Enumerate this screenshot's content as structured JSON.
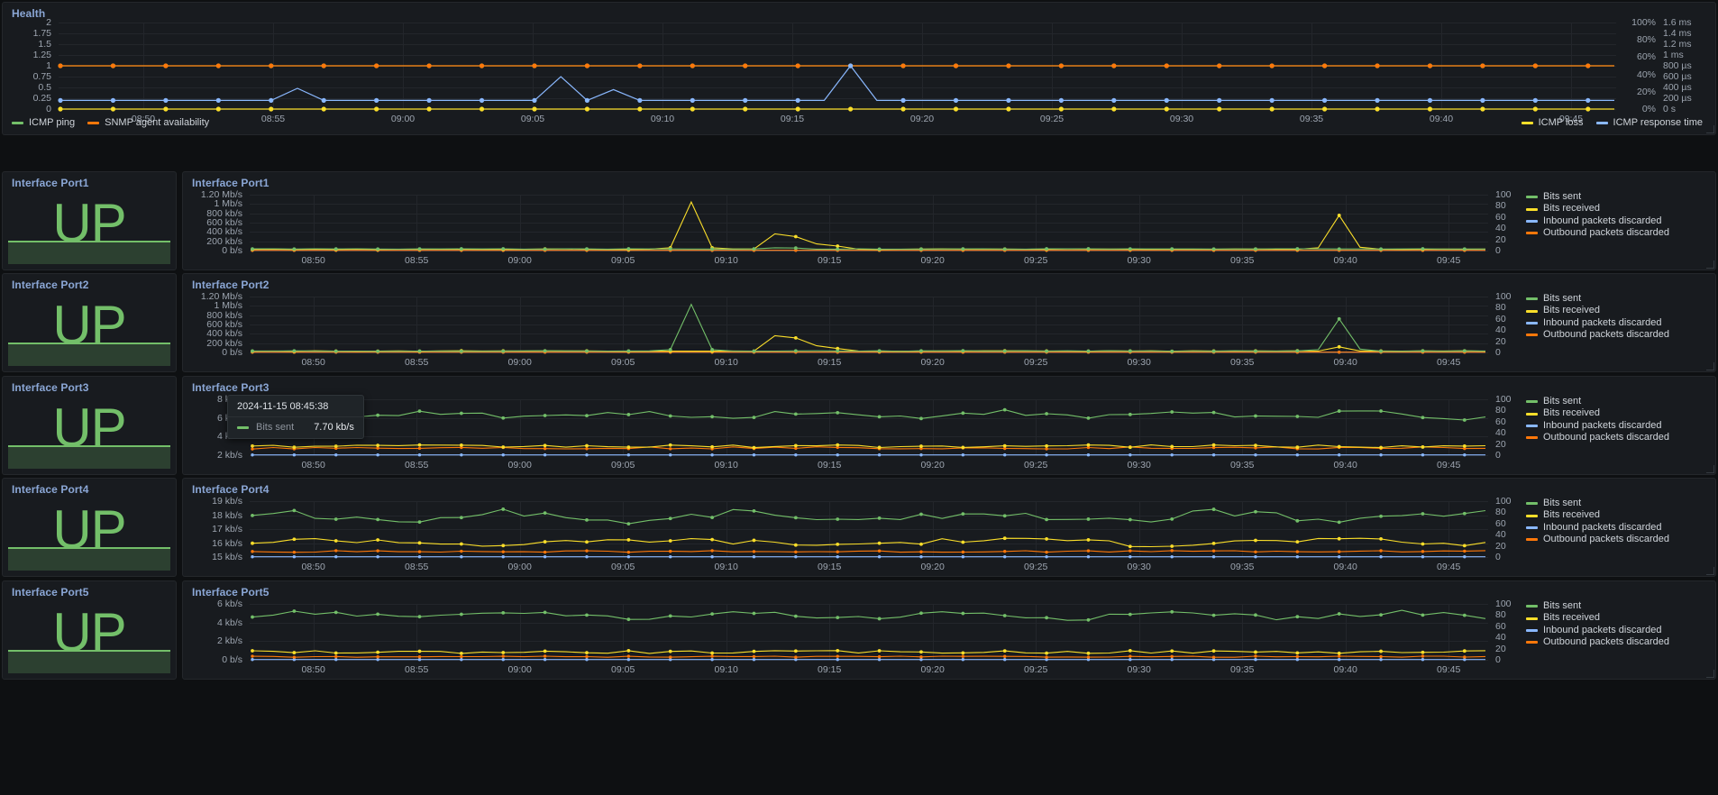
{
  "theme": {
    "bg": "#0e1012",
    "panel_bg": "#181b1f",
    "title_color": "#8ba7d6",
    "green": "#73bf69",
    "yellow": "#fade2a",
    "blue": "#8ab8ff",
    "orange": "#ff780a",
    "dark_yellow": "#e0b400"
  },
  "health": {
    "title": "Health",
    "y_left_ticks": [
      "2",
      "1.75",
      "1.5",
      "1.25",
      "1",
      "0.75",
      "0.5",
      "0.25",
      "0"
    ],
    "y_right1_ticks": [
      "100%",
      "80%",
      "60%",
      "40%",
      "20%",
      "0%"
    ],
    "y_right2_ticks": [
      "1.6 ms",
      "1.4 ms",
      "1.2 ms",
      "1 ms",
      "800 µs",
      "600 µs",
      "400 µs",
      "200 µs",
      "0 s"
    ],
    "x_ticks": [
      "08:50",
      "08:55",
      "09:00",
      "09:05",
      "09:10",
      "09:15",
      "09:20",
      "09:25",
      "09:30",
      "09:35",
      "09:40",
      "09:45"
    ],
    "legend_left": [
      {
        "label": "ICMP ping",
        "color": "#73bf69"
      },
      {
        "label": "SNMP agent availability",
        "color": "#ff780a"
      }
    ],
    "legend_right": [
      {
        "label": "ICMP loss",
        "color": "#fade2a"
      },
      {
        "label": "ICMP response time",
        "color": "#8ab8ff"
      }
    ]
  },
  "chart_data": [
    {
      "id": "health",
      "type": "line",
      "title": "Health",
      "xlabel": "",
      "ylabel": "",
      "ylim": [
        0,
        2
      ],
      "grid": true,
      "legend_position": "bottom",
      "x": [
        "08:46",
        "08:47",
        "08:48",
        "08:49",
        "08:50",
        "08:51",
        "08:52",
        "08:53",
        "08:54",
        "08:55",
        "08:56",
        "08:57",
        "08:58",
        "08:59",
        "09:00",
        "09:01",
        "09:02",
        "09:03",
        "09:04",
        "09:05",
        "09:06",
        "09:07",
        "09:08",
        "09:09",
        "09:10",
        "09:11",
        "09:12",
        "09:13",
        "09:14",
        "09:15",
        "09:16",
        "09:17",
        "09:18",
        "09:19",
        "09:20",
        "09:21",
        "09:22",
        "09:23",
        "09:24",
        "09:25",
        "09:26",
        "09:27",
        "09:28",
        "09:29",
        "09:30",
        "09:31",
        "09:32",
        "09:33",
        "09:34",
        "09:35",
        "09:36",
        "09:37",
        "09:38",
        "09:39",
        "09:40",
        "09:41",
        "09:42",
        "09:43",
        "09:44",
        "09:45"
      ],
      "series": [
        {
          "name": "ICMP ping",
          "color": "#73bf69",
          "axis": "left",
          "unit": "",
          "values": [
            1,
            1,
            1,
            1,
            1,
            1,
            1,
            1,
            1,
            1,
            1,
            1,
            1,
            1,
            1,
            1,
            1,
            1,
            1,
            1,
            1,
            1,
            1,
            1,
            1,
            1,
            1,
            1,
            1,
            1,
            1,
            1,
            1,
            1,
            1,
            1,
            1,
            1,
            1,
            1,
            1,
            1,
            1,
            1,
            1,
            1,
            1,
            1,
            1,
            1,
            1,
            1,
            1,
            1,
            1,
            1,
            1,
            1,
            1,
            1
          ]
        },
        {
          "name": "SNMP agent availability",
          "color": "#ff780a",
          "axis": "left",
          "unit": "",
          "values": [
            1,
            1,
            1,
            1,
            1,
            1,
            1,
            1,
            1,
            1,
            1,
            1,
            1,
            1,
            1,
            1,
            1,
            1,
            1,
            1,
            1,
            1,
            1,
            1,
            1,
            1,
            1,
            1,
            1,
            1,
            1,
            1,
            1,
            1,
            1,
            1,
            1,
            1,
            1,
            1,
            1,
            1,
            1,
            1,
            1,
            1,
            1,
            1,
            1,
            1,
            1,
            1,
            1,
            1,
            1,
            1,
            1,
            1,
            1,
            1
          ]
        },
        {
          "name": "ICMP loss",
          "color": "#fade2a",
          "axis": "right-percent",
          "unit": "%",
          "values": [
            0,
            0,
            0,
            0,
            0,
            0,
            0,
            0,
            0,
            0,
            0,
            0,
            0,
            0,
            0,
            0,
            0,
            0,
            0,
            0,
            0,
            0,
            0,
            0,
            0,
            0,
            0,
            0,
            0,
            0,
            0,
            0,
            0,
            0,
            0,
            0,
            0,
            0,
            0,
            0,
            0,
            0,
            0,
            0,
            0,
            0,
            0,
            0,
            0,
            0,
            0,
            0,
            0,
            0,
            0,
            0,
            0,
            0,
            0,
            0
          ]
        },
        {
          "name": "ICMP response time",
          "color": "#8ab8ff",
          "axis": "right-time",
          "unit": "ms",
          "values": [
            0.2,
            0.2,
            0.2,
            0.2,
            0.2,
            0.2,
            0.2,
            0.2,
            0.2,
            0.48,
            0.2,
            0.2,
            0.2,
            0.2,
            0.2,
            0.2,
            0.2,
            0.2,
            0.2,
            0.75,
            0.2,
            0.45,
            0.2,
            0.2,
            0.2,
            0.2,
            0.2,
            0.2,
            0.2,
            0.2,
            1.0,
            0.2,
            0.2,
            0.2,
            0.2,
            0.2,
            0.2,
            0.2,
            0.2,
            0.2,
            0.2,
            0.2,
            0.2,
            0.2,
            0.2,
            0.2,
            0.2,
            0.2,
            0.2,
            0.2,
            0.2,
            0.2,
            0.2,
            0.2,
            0.2,
            0.2,
            0.2,
            0.2,
            0.2,
            0.2
          ]
        }
      ]
    },
    {
      "id": "port1",
      "type": "line",
      "title": "Interface Port1",
      "ylim": [
        0,
        1200000
      ],
      "y_ticks": [
        "1.20 Mb/s",
        "1 Mb/s",
        "800 kb/s",
        "600 kb/s",
        "400 kb/s",
        "200 kb/s",
        "0 b/s"
      ],
      "y_right_ticks": [
        "100",
        "80",
        "60",
        "40",
        "20",
        "0"
      ],
      "series": [
        {
          "name": "Bits sent",
          "color": "#73bf69",
          "values_peak_kbps": 40
        },
        {
          "name": "Bits received",
          "color": "#fade2a",
          "values_peak_kbps": 1050
        },
        {
          "name": "Inbound packets discarded",
          "color": "#8ab8ff",
          "values_peak_kbps": 0
        },
        {
          "name": "Outbound packets discarded",
          "color": "#ff780a",
          "values_peak_kbps": 0
        }
      ]
    },
    {
      "id": "port2",
      "type": "line",
      "title": "Interface Port2",
      "ylim": [
        0,
        1200000
      ],
      "y_ticks": [
        "1.20 Mb/s",
        "1 Mb/s",
        "800 kb/s",
        "600 kb/s",
        "400 kb/s",
        "200 kb/s",
        "0 b/s"
      ],
      "y_right_ticks": [
        "100",
        "80",
        "60",
        "40",
        "20",
        "0"
      ],
      "series": [
        {
          "name": "Bits sent",
          "color": "#73bf69",
          "values_peak_kbps": 1010
        },
        {
          "name": "Bits received",
          "color": "#fade2a",
          "values_peak_kbps": 330
        },
        {
          "name": "Inbound packets discarded",
          "color": "#8ab8ff",
          "values_peak_kbps": 0
        },
        {
          "name": "Outbound packets discarded",
          "color": "#ff780a",
          "values_peak_kbps": 0
        }
      ]
    },
    {
      "id": "port3",
      "type": "line",
      "title": "Interface Port3",
      "ylim": [
        1000,
        9000
      ],
      "y_ticks": [
        "8 kb/s",
        "6 kb/s",
        "4 kb/s",
        "2 kb/s"
      ],
      "y_right_ticks": [
        "100",
        "80",
        "60",
        "40",
        "20",
        "0"
      ],
      "series": [
        {
          "name": "Bits sent",
          "color": "#73bf69",
          "values_avg_kbps": 7.0
        },
        {
          "name": "Bits received",
          "color": "#fade2a",
          "values_avg_kbps": 2.0
        },
        {
          "name": "Inbound packets discarded",
          "color": "#8ab8ff",
          "values_avg_kbps": 0
        },
        {
          "name": "Outbound packets discarded",
          "color": "#ff780a",
          "values_avg_kbps": 1.85
        }
      ]
    },
    {
      "id": "port4",
      "type": "line",
      "title": "Interface Port4",
      "ylim": [
        14500,
        19500
      ],
      "y_ticks": [
        "19 kb/s",
        "18 kb/s",
        "17 kb/s",
        "16 kb/s",
        "15 kb/s"
      ],
      "y_right_ticks": [
        "100",
        "80",
        "60",
        "40",
        "20",
        "0"
      ],
      "series": [
        {
          "name": "Bits sent",
          "color": "#73bf69",
          "values_avg_kbps": 18.3
        },
        {
          "name": "Bits received",
          "color": "#fade2a",
          "values_avg_kbps": 16.0
        },
        {
          "name": "Inbound packets discarded",
          "color": "#8ab8ff",
          "values_avg_kbps": 0
        },
        {
          "name": "Outbound packets discarded",
          "color": "#ff780a",
          "values_avg_kbps": 15.1
        }
      ]
    },
    {
      "id": "port5",
      "type": "line",
      "title": "Interface Port5",
      "ylim": [
        0,
        7000
      ],
      "y_ticks": [
        "6 kb/s",
        "4 kb/s",
        "2 kb/s",
        "0 b/s"
      ],
      "y_right_ticks": [
        "100",
        "80",
        "60",
        "40",
        "20",
        "0"
      ],
      "series": [
        {
          "name": "Bits sent",
          "color": "#73bf69",
          "values_avg_kbps": 5.8
        },
        {
          "name": "Bits received",
          "color": "#fade2a",
          "values_avg_kbps": 0.9
        },
        {
          "name": "Inbound packets discarded",
          "color": "#8ab8ff",
          "values_avg_kbps": 0
        },
        {
          "name": "Outbound packets discarded",
          "color": "#ff780a",
          "values_avg_kbps": 0.1
        }
      ]
    }
  ],
  "graph_legend": [
    {
      "label": "Bits sent",
      "color": "#73bf69"
    },
    {
      "label": "Bits received",
      "color": "#fade2a"
    },
    {
      "label": "Inbound packets discarded",
      "color": "#8ab8ff"
    },
    {
      "label": "Outbound packets discarded",
      "color": "#ff780a"
    }
  ],
  "x_ticks": [
    "08:50",
    "08:55",
    "09:00",
    "09:05",
    "09:10",
    "09:15",
    "09:20",
    "09:25",
    "09:30",
    "09:35",
    "09:40",
    "09:45"
  ],
  "ports": [
    {
      "title": "Interface Port1",
      "status": "UP"
    },
    {
      "title": "Interface Port2",
      "status": "UP"
    },
    {
      "title": "Interface Port3",
      "status": "UP"
    },
    {
      "title": "Interface Port4",
      "status": "UP"
    },
    {
      "title": "Interface Port5",
      "status": "UP"
    }
  ],
  "tooltip": {
    "time": "2024-11-15 08:45:38",
    "series_label": "Bits sent",
    "series_value": "7.70 kb/s",
    "series_color": "#73bf69"
  }
}
